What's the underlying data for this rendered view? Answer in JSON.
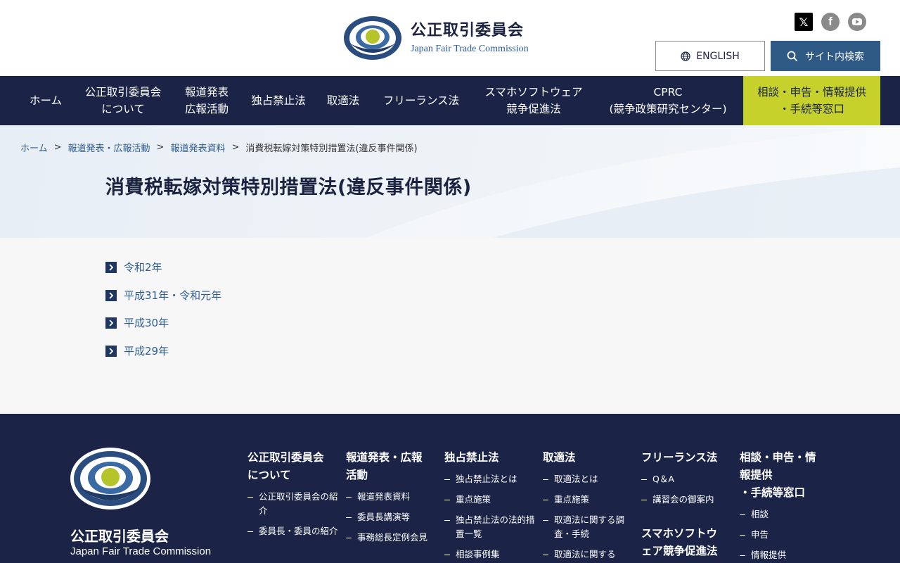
{
  "header": {
    "org_name_jp": "公正取引委員会",
    "org_name_en": "Japan Fair Trade Commission",
    "english_button": "ENGLISH",
    "search_button": "サイト内検索",
    "sns": [
      "x-icon",
      "facebook-icon",
      "youtube-icon"
    ]
  },
  "nav": {
    "home": "ホーム",
    "about_1": "公正取引委員会",
    "about_2": "について",
    "press_1": "報道発表",
    "press_2": "広報活動",
    "antimonopoly": "独占禁止法",
    "subcontract": "取適法",
    "freelance": "フリーランス法",
    "smartphone_1": "スマホソフトウェア",
    "smartphone_2": "競争促進法",
    "cprc_1": "CPRC",
    "cprc_2": "(競争政策研究センター)",
    "consult_1": "相談・申告・情報提供",
    "consult_2": "・手続等窓口"
  },
  "breadcrumb": {
    "home": "ホーム",
    "press": "報道発表・広報活動",
    "materials": "報道発表資料",
    "current": "消費税転嫁対策特別措置法(違反事件関係)",
    "separator": ">"
  },
  "page": {
    "title": "消費税転嫁対策特別措置法(違反事件関係)",
    "links": [
      "令和2年",
      "平成31年・令和元年",
      "平成30年",
      "平成29年"
    ]
  },
  "footer": {
    "org_name_jp": "公正取引委員会",
    "org_name_en": "Japan Fair Trade Commission",
    "col1": {
      "head_1": "公正取引委員会",
      "head_2": "について",
      "items": [
        "公正取引委員会の紹介",
        "委員長・委員の紹介"
      ]
    },
    "col2": {
      "head_1": "報道発表・広報",
      "head_2": "活動",
      "items": [
        "報道発表資料",
        "委員長講演等",
        "事務総長定例会見"
      ]
    },
    "col3": {
      "head_1": "独占禁止法",
      "items": [
        "独占禁止法とは",
        "重点施策",
        "独占禁止法の法的措置一覧",
        "相談事例集"
      ]
    },
    "col4": {
      "head_1": "取適法",
      "items": [
        "取適法とは",
        "重点施策",
        "取適法に関する調査・手続",
        "取適法に関する"
      ]
    },
    "col5": {
      "head_1": "フリーランス法",
      "items": [
        "Q＆A",
        "講習会の御案内"
      ],
      "head2_1": "スマホソフトウ",
      "head2_2": "ェア競争促進法"
    },
    "col6": {
      "head_1": "相談・申告・情",
      "head_2": "報提供",
      "head_3": "・手続等窓口",
      "items": [
        "相談",
        "申告",
        "情報提供"
      ]
    }
  },
  "colors": {
    "navy": "#1b2346",
    "accent_green": "#c6d12b",
    "link_blue": "#2b5c92",
    "button_blue": "#2f5a86"
  }
}
